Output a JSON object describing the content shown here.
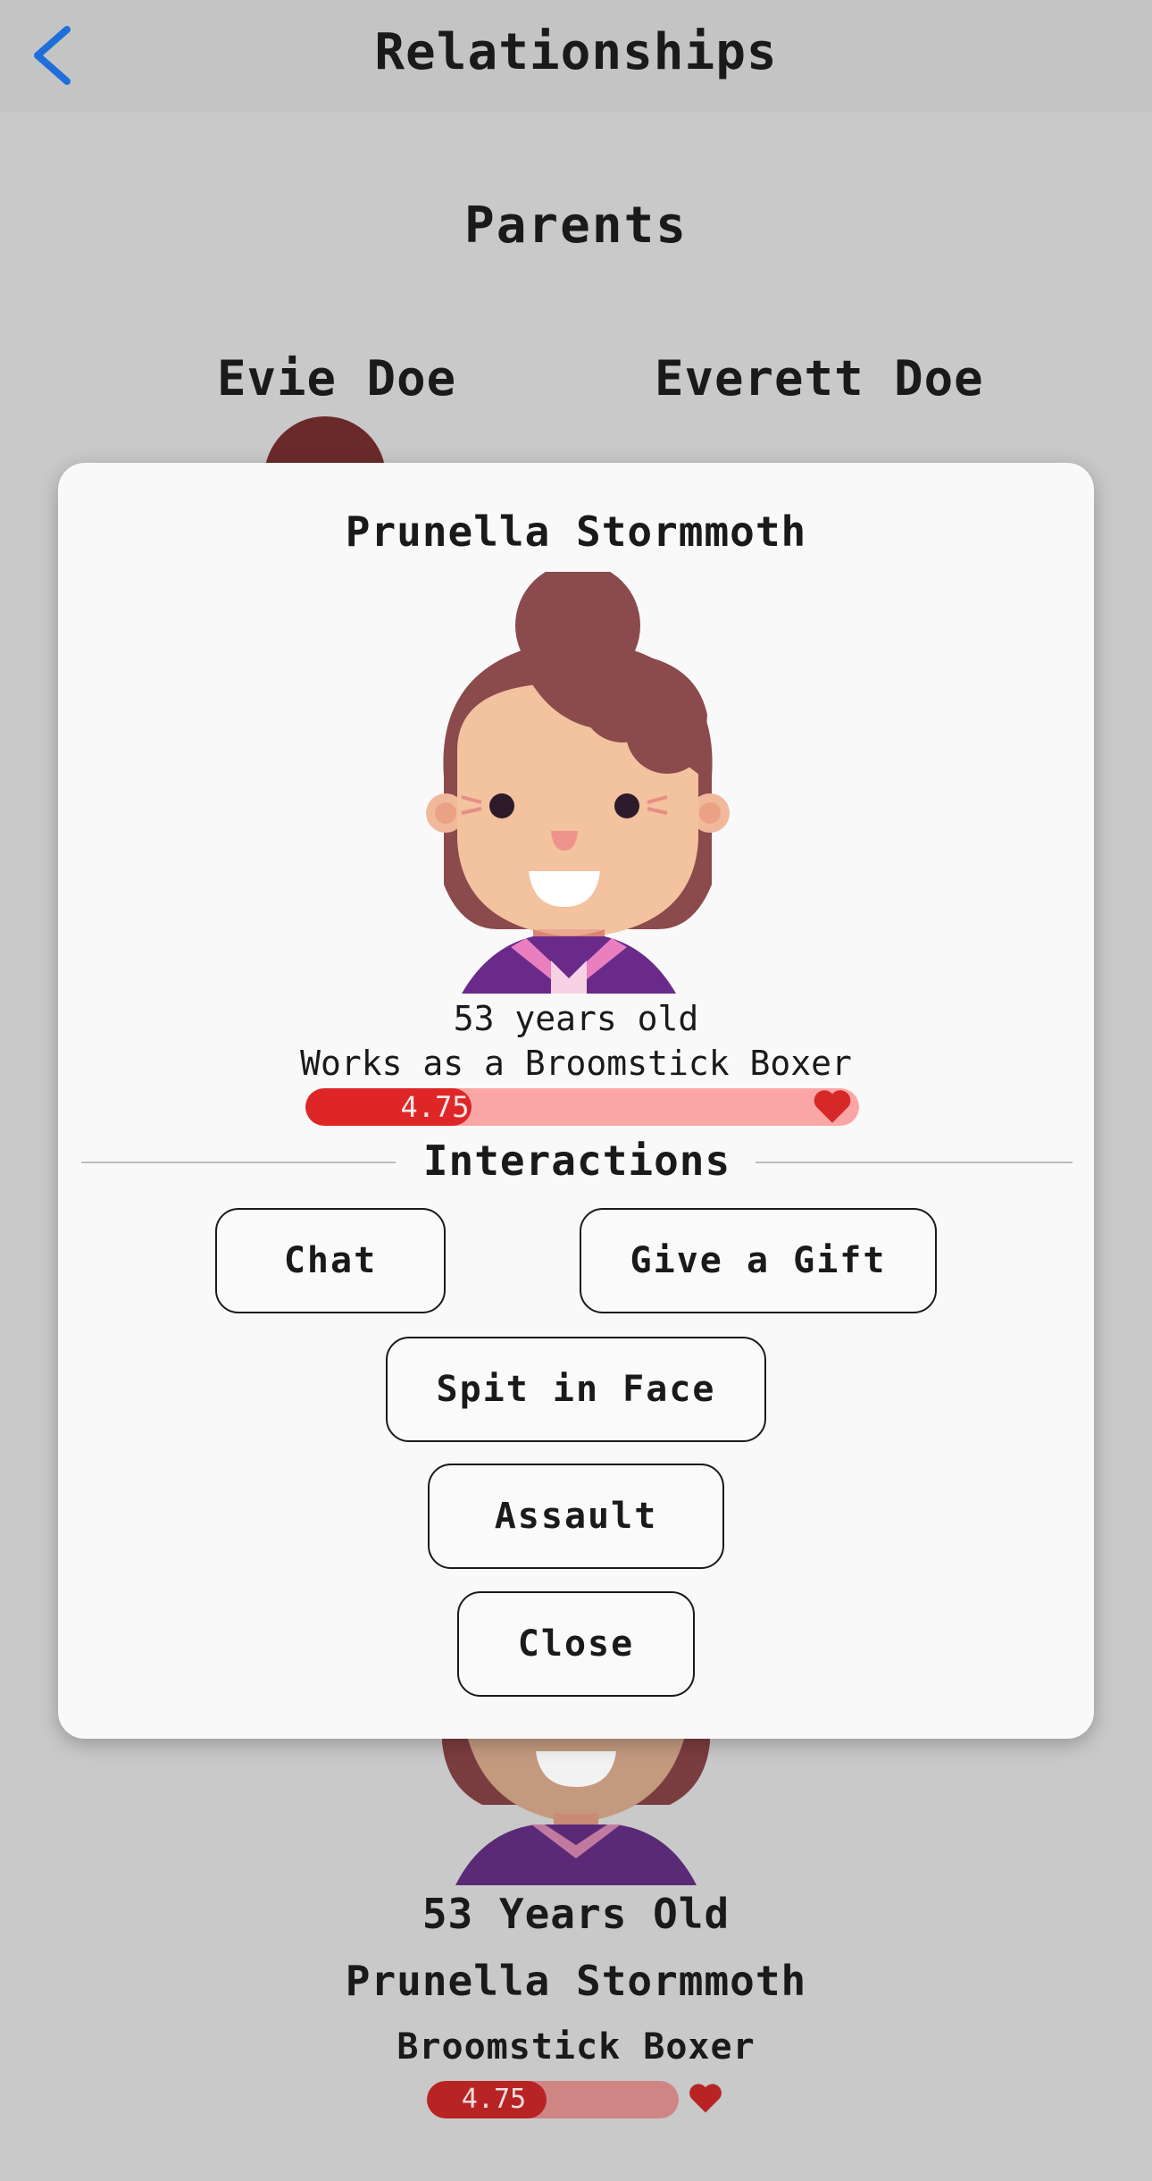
{
  "header": {
    "title": "Relationships",
    "back_icon": "chevron-left-icon"
  },
  "section_title": "Parents",
  "parents": [
    {
      "name": "Evie Doe"
    },
    {
      "name": "Everett Doe"
    }
  ],
  "background_card": {
    "age_text": "53 Years Old",
    "name": "Prunella Stormmoth",
    "job": "Broomstick Boxer",
    "relationship_label": "4.75",
    "relationship_fraction": 0.475
  },
  "modal": {
    "name": "Prunella Stormmoth",
    "age_text": "53 years old",
    "job_text": "Works as a Broomstick Boxer",
    "relationship_label": "4.75",
    "relationship_fraction": 0.3,
    "interactions_title": "Interactions",
    "buttons": {
      "chat": "Chat",
      "gift": "Give a Gift",
      "spit": "Spit in Face",
      "assault": "Assault",
      "close": "Close"
    }
  },
  "colors": {
    "accent_blue": "#1e6fd9",
    "bar_fill": "#df2626",
    "bar_track": "#fba6a6",
    "heart": "#d62828"
  }
}
